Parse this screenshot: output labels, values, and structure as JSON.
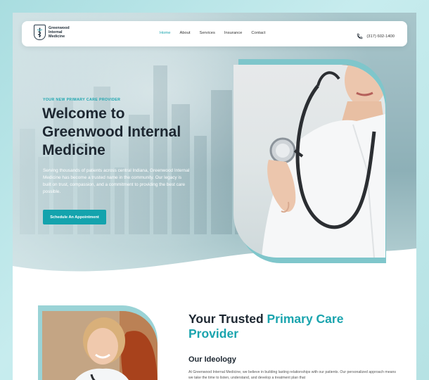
{
  "nav": {
    "logo_lines": [
      "Greenwood",
      "Internal",
      "Medicine"
    ],
    "items": [
      {
        "label": "Home",
        "active": true
      },
      {
        "label": "About",
        "active": false
      },
      {
        "label": "Services",
        "active": false
      },
      {
        "label": "Insurance",
        "active": false
      },
      {
        "label": "Contact",
        "active": false
      }
    ],
    "phone": "(317) 602-1400",
    "phone_icon": "phone-icon"
  },
  "hero": {
    "eyebrow": "YOUR NEW PRIMARY CARE PROVIDER",
    "title_lines": [
      "Welcome to",
      "Greenwood Internal",
      "Medicine"
    ],
    "description": "Serving thousands of patients across central Indiana, Greenwood Internal Medicine has become a trusted name in the community. Our legacy is built on trust, compassion, and a commitment to providing the best care possible.",
    "cta_label": "Schedule An Appointment"
  },
  "section2": {
    "title_plain": "Your Trusted ",
    "title_highlight": "Primary Care Provider",
    "subtitle": "Our Ideology",
    "body": "At Greenwood Internal Medicine, we believe in building lasting relationships with our patients. Our personalized approach means we take the time to listen, understand, and develop a treatment plan that"
  },
  "colors": {
    "accent": "#14a3ad",
    "heading": "#1d2731",
    "page_bg": "#b6e2e4"
  }
}
